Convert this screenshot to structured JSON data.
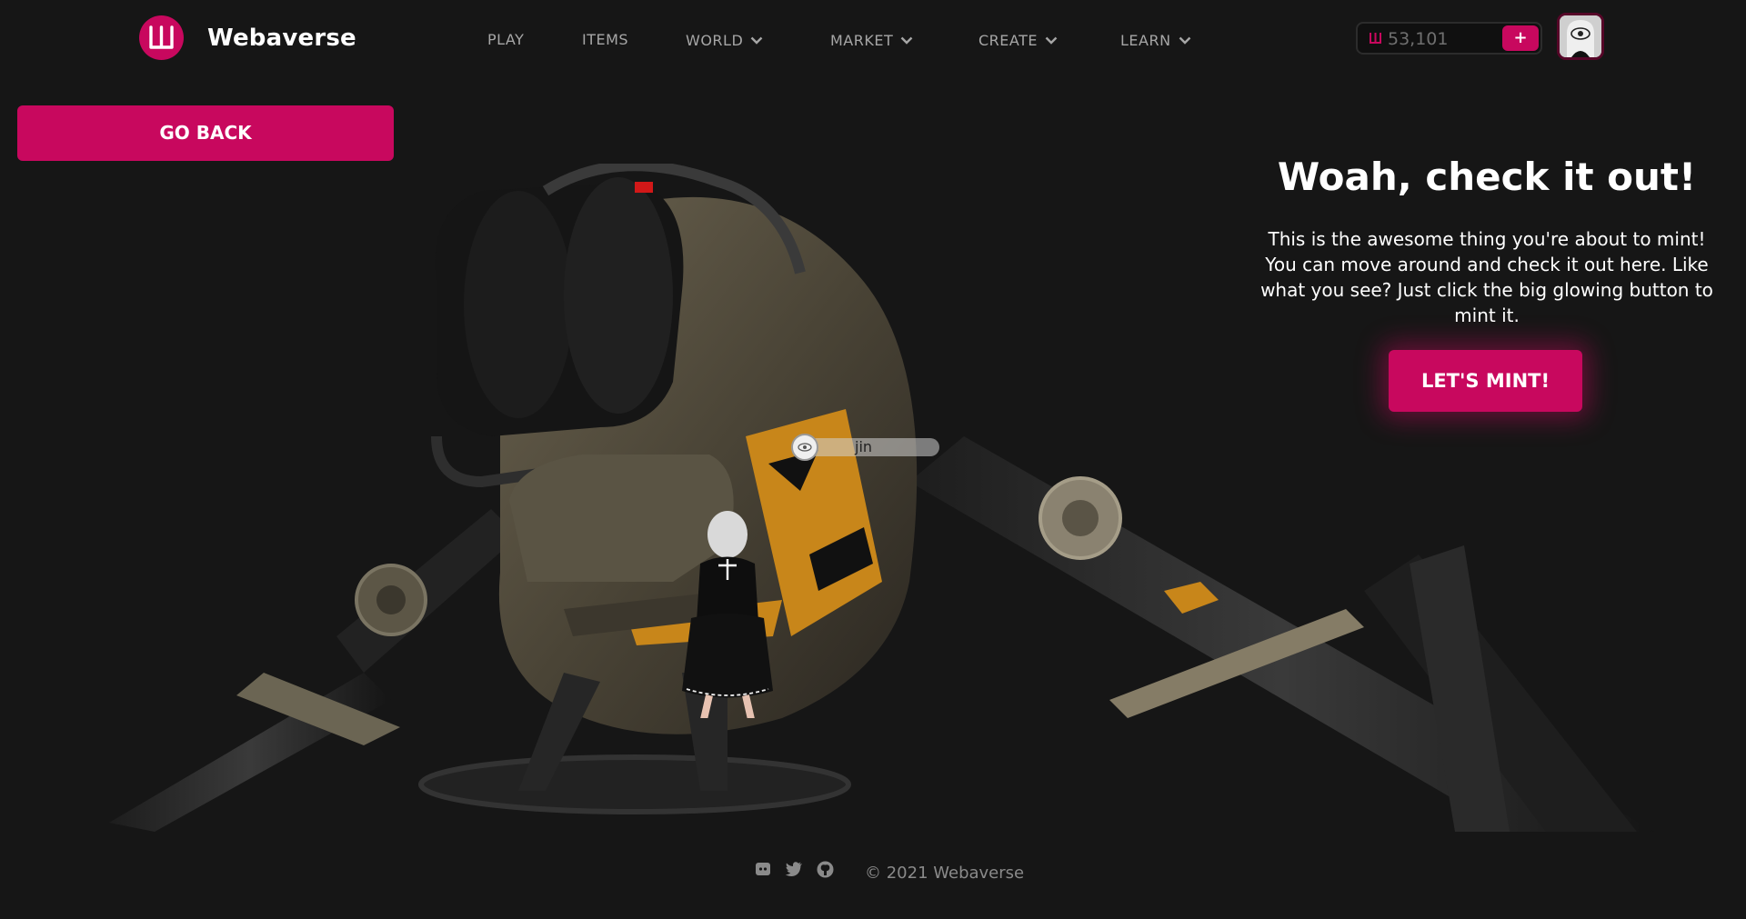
{
  "header": {
    "brand": "Webaverse",
    "nav": [
      {
        "label": "PLAY",
        "dropdown": false
      },
      {
        "label": "ITEMS",
        "dropdown": false
      },
      {
        "label": "WORLD",
        "dropdown": true
      },
      {
        "label": "MARKET",
        "dropdown": true
      },
      {
        "label": "CREATE",
        "dropdown": true
      },
      {
        "label": "LEARN",
        "dropdown": true
      }
    ],
    "balance": {
      "currency_icon": "webaverse-currency-icon",
      "amount": "53,101",
      "add_label": "+"
    },
    "avatar_icon": "user-avatar"
  },
  "go_back_label": "GO BACK",
  "preview": {
    "title": "Woah, check it out!",
    "description": "This is the awesome thing you're about to mint! You can move around and check it out here. Like what you see? Just click the big glowing button to mint it.",
    "mint_label": "LET'S MINT!",
    "player_name": "jin"
  },
  "footer": {
    "icons": [
      "discord-icon",
      "twitter-icon",
      "github-icon"
    ],
    "copyright": "© 2021 Webaverse"
  },
  "colors": {
    "accent": "#c8085e",
    "background": "#161616",
    "nav_text": "#a6a6a6"
  }
}
